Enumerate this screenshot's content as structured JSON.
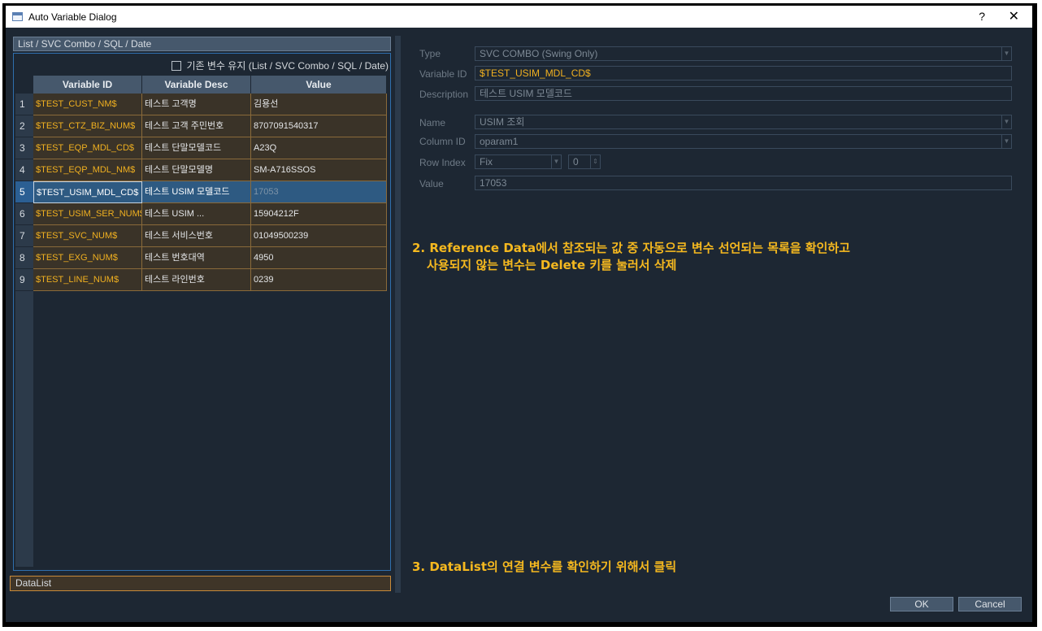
{
  "window": {
    "title": "Auto Variable Dialog",
    "help_label": "?",
    "close_label": "✕"
  },
  "left": {
    "section_header": "List / SVC Combo / SQL / Date",
    "keep_checkbox_label": "기존 변수 유지 (List / SVC Combo / SQL / Date)",
    "columns": [
      "Variable ID",
      "Variable Desc",
      "Value"
    ],
    "rows": [
      {
        "num": "1",
        "id": "$TEST_CUST_NM$",
        "desc": "테스트 고객명",
        "value": "김용선"
      },
      {
        "num": "2",
        "id": "$TEST_CTZ_BIZ_NUM$",
        "desc": "테스트 고객 주민번호",
        "value": "8707091540317"
      },
      {
        "num": "3",
        "id": "$TEST_EQP_MDL_CD$",
        "desc": "테스트 단말모델코드",
        "value": "A23Q"
      },
      {
        "num": "4",
        "id": "$TEST_EQP_MDL_NM$",
        "desc": "테스트 단말모델명",
        "value": "SM-A716SSOS"
      },
      {
        "num": "5",
        "id": "$TEST_USIM_MDL_CD$",
        "desc": "테스트 USIM 모델코드",
        "value": "17053"
      },
      {
        "num": "6",
        "id": "$TEST_USIM_SER_NUM$",
        "desc": "테스트 USIM ...",
        "value": "15904212F"
      },
      {
        "num": "7",
        "id": "$TEST_SVC_NUM$",
        "desc": "테스트 서비스번호",
        "value": "01049500239"
      },
      {
        "num": "8",
        "id": "$TEST_EXG_NUM$",
        "desc": "테스트 번호대역",
        "value": "4950"
      },
      {
        "num": "9",
        "id": "$TEST_LINE_NUM$",
        "desc": "테스트 라인번호",
        "value": "0239"
      }
    ],
    "selected_row": "5",
    "datalist_label": "DataList"
  },
  "form": {
    "type_label": "Type",
    "type_value": "SVC COMBO (Swing Only)",
    "varid_label": "Variable ID",
    "varid_value": "$TEST_USIM_MDL_CD$",
    "desc_label": "Description",
    "desc_value": "테스트 USIM 모델코드",
    "name_label": "Name",
    "name_value": "USIM 조회",
    "column_label": "Column ID",
    "column_value": "oparam1",
    "rowindex_label": "Row Index",
    "rowindex_mode": "Fix",
    "rowindex_value": "0",
    "value_label": "Value",
    "value_value": "17053"
  },
  "annotations": {
    "step2_line1": "2. Reference Data에서 참조되는 값 중 자동으로 변수 선언되는 목록을 확인하고",
    "step2_line2": "사용되지 않는 변수는 Delete 키를 눌러서 삭제",
    "step3": "3. DataList의 연결 변수를 확인하기 위해서 클릭"
  },
  "buttons": {
    "ok": "OK",
    "cancel": "Cancel"
  },
  "colors": {
    "accent": "#f5b81f",
    "selection": "#2e5a82",
    "background": "#1d2733"
  }
}
